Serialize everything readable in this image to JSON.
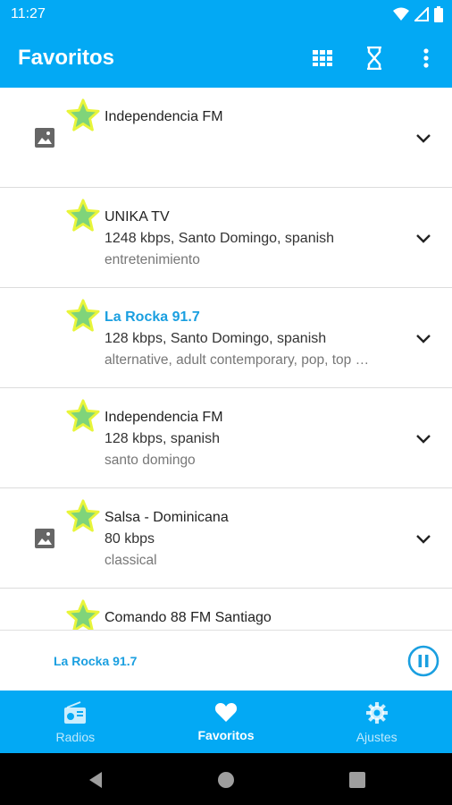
{
  "status": {
    "time": "11:27",
    "icons": [
      "wifi-icon",
      "signal-icon",
      "battery-icon"
    ]
  },
  "header": {
    "title": "Favoritos",
    "actions": [
      "grid-view-icon",
      "sleep-timer-icon",
      "more-vert-icon"
    ]
  },
  "stations": [
    {
      "name": "Independencia FM",
      "info": "",
      "tags": "",
      "has_thumb": true,
      "active": false
    },
    {
      "name": "UNIKA TV",
      "info": "1248 kbps, Santo Domingo, spanish",
      "tags": "entretenimiento",
      "has_thumb": false,
      "active": false
    },
    {
      "name": "La Rocka 91.7",
      "info": "128 kbps, Santo Domingo, spanish",
      "tags": "alternative, adult contemporary, pop, top …",
      "has_thumb": false,
      "active": true
    },
    {
      "name": "Independencia FM",
      "info": "128 kbps, spanish",
      "tags": "santo domingo",
      "has_thumb": false,
      "active": false
    },
    {
      "name": "Salsa - Dominicana",
      "info": "80 kbps",
      "tags": "classical",
      "has_thumb": true,
      "active": false
    },
    {
      "name": "Comando 88 FM Santiago",
      "info": "",
      "tags": "",
      "has_thumb": false,
      "active": false
    }
  ],
  "player": {
    "now_playing": "La Rocka 91.7"
  },
  "nav": {
    "items": [
      {
        "label": "Radios",
        "icon": "radio-icon"
      },
      {
        "label": "Favoritos",
        "icon": "heart-icon"
      },
      {
        "label": "Ajustes",
        "icon": "gear-icon"
      }
    ],
    "active": "Favoritos"
  },
  "colors": {
    "primary": "#03a9f4",
    "accent_text": "#1a9fe0",
    "star_fill": "#7fd47a",
    "star_outline": "#e8f53a"
  }
}
